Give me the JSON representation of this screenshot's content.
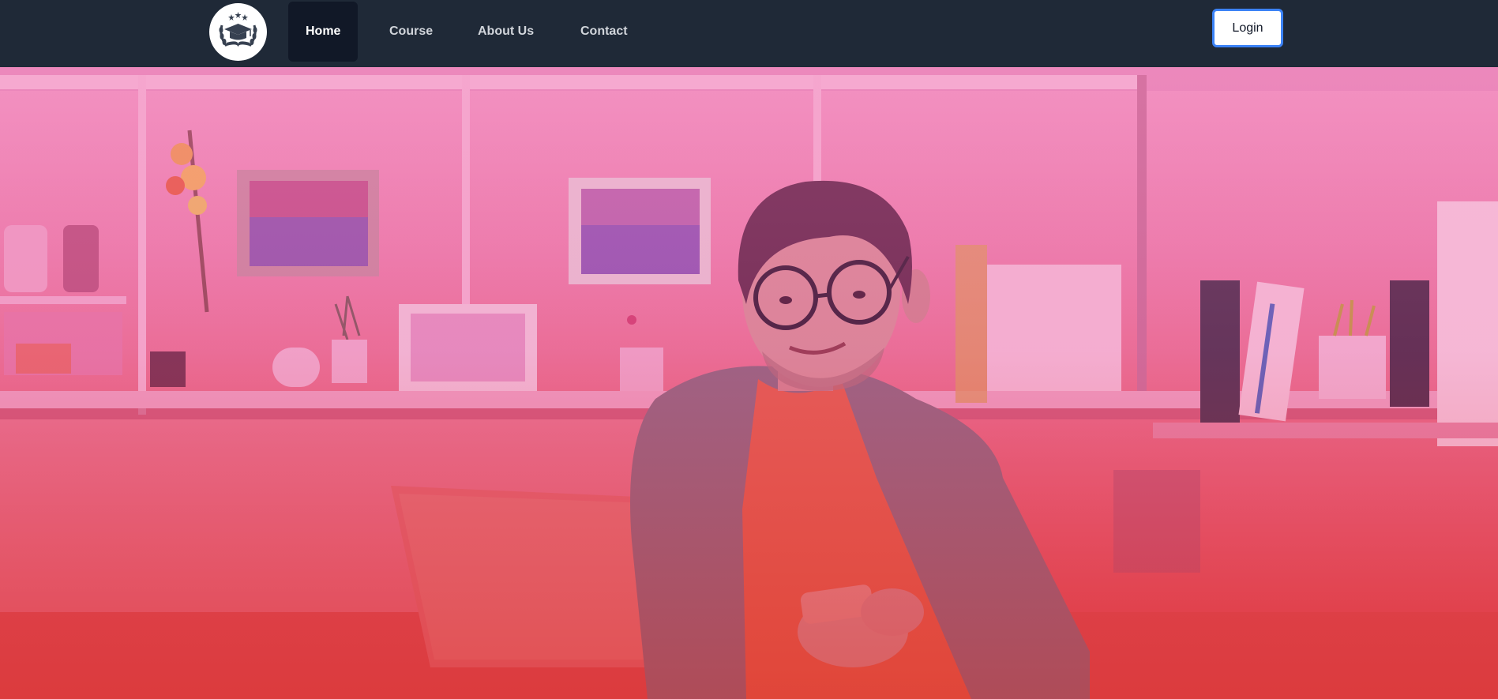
{
  "navbar": {
    "logo_icon": "graduation-cap-laurel-icon",
    "links": [
      {
        "label": "Home",
        "active": true
      },
      {
        "label": "Course",
        "active": false
      },
      {
        "label": "About Us",
        "active": false
      },
      {
        "label": "Contact",
        "active": false
      }
    ],
    "login_label": "Login"
  },
  "hero": {
    "image": "student-with-glasses-at-laptop",
    "overlay_colors": [
      "#f472b6",
      "#dc2626"
    ]
  },
  "colors": {
    "navbar_bg": "#1f2937",
    "active_link_bg": "#111827",
    "login_border": "#3b82f6"
  }
}
